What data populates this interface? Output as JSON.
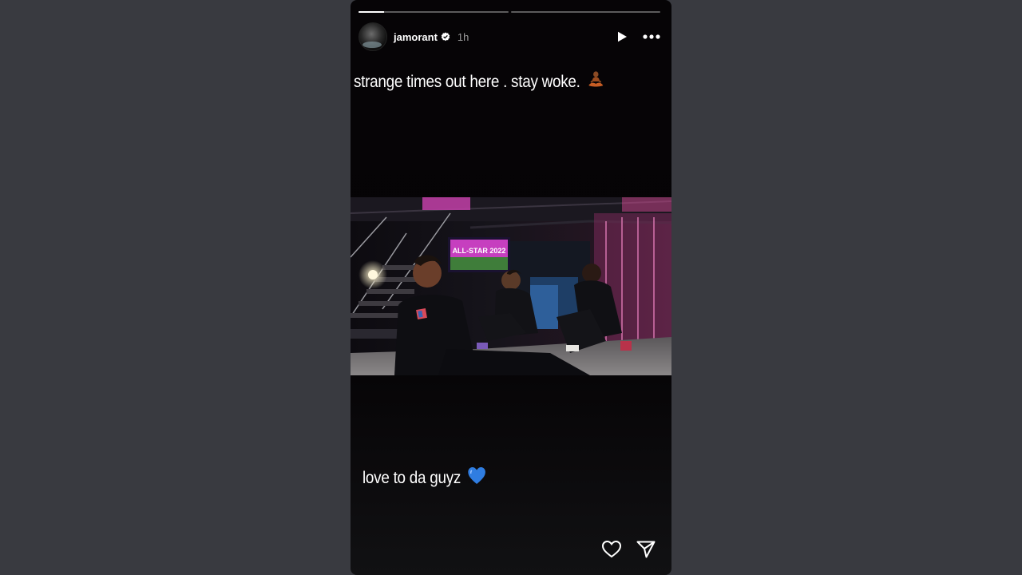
{
  "story": {
    "progress": [
      0.17,
      0.0
    ],
    "user": {
      "username": "jamorant",
      "time_ago": "1h",
      "verified": true
    },
    "captions": {
      "top": "strange times out here . stay woke.",
      "top_emoji": "person-in-lotus-position",
      "bottom": "love to da guyz",
      "bottom_emoji": "blue-heart"
    },
    "photo": {
      "sign_text": "ALL-STAR 2022"
    },
    "icons": {
      "play": "play-icon",
      "more": "more-icon",
      "like": "heart-icon",
      "share": "send-icon"
    },
    "colors": {
      "background": "#393a40",
      "story_bg": "#060406",
      "text": "#ffffff",
      "muted": "#9b9b9b",
      "heart_blue": "#2f7de1",
      "sign_magenta": "#c63fbf"
    }
  }
}
